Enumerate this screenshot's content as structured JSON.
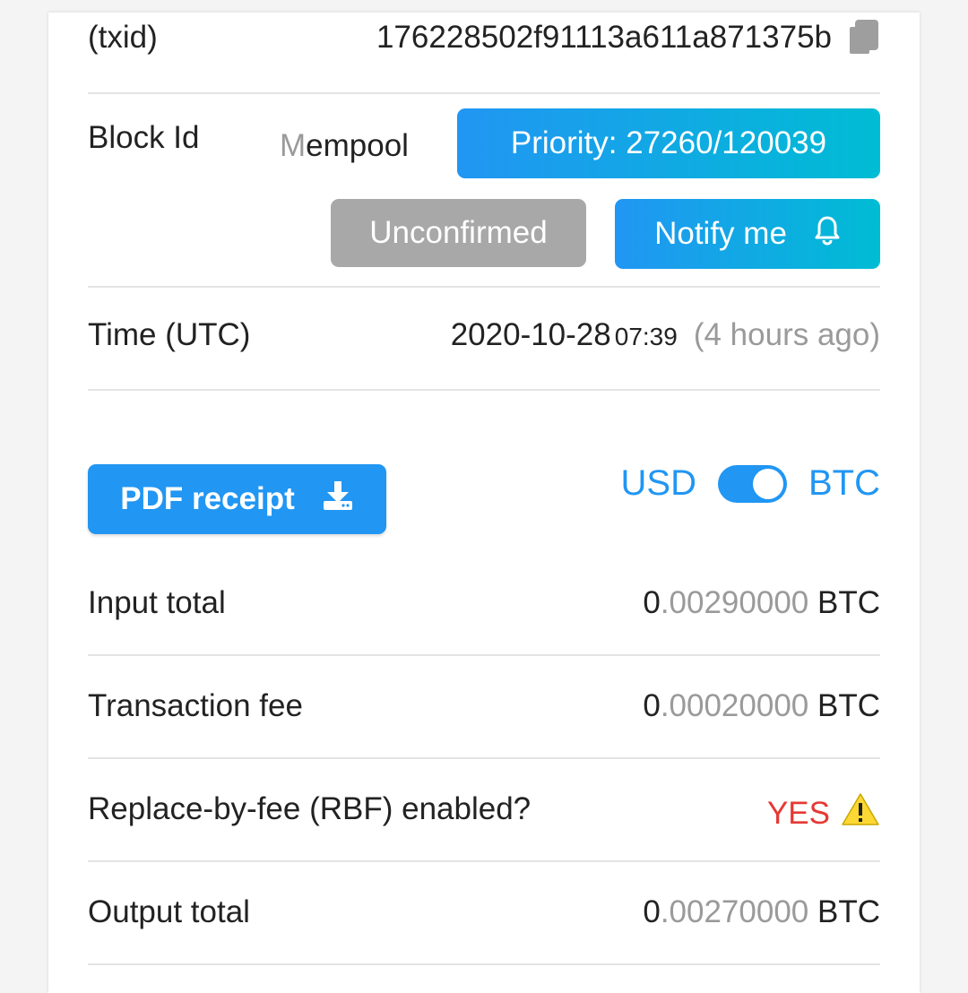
{
  "txid": {
    "label": "(txid)",
    "value": "176228502f91113a611a871375b",
    "copy_icon": "copy-icon"
  },
  "block": {
    "label": "Block Id",
    "mempool_first": "M",
    "mempool_rest": "empool",
    "priority": "Priority: 27260/120039",
    "status": "Unconfirmed",
    "notify_label": "Notify me",
    "notify_icon": "bell-icon"
  },
  "time": {
    "label": "Time (UTC)",
    "date": "2020-10-28",
    "clock": "07:39",
    "relative": "(4 hours ago)"
  },
  "actions": {
    "pdf_label": "PDF receipt",
    "pdf_icon": "download-icon",
    "currency_left": "USD",
    "currency_right": "BTC",
    "toggle_on": true
  },
  "summary": {
    "input_total": {
      "label": "Input total",
      "int": "0",
      "dec": ".00290000",
      "unit": " BTC"
    },
    "transaction_fee": {
      "label": "Transaction fee",
      "int": "0",
      "dec": ".00020000",
      "unit": " BTC"
    },
    "rbf": {
      "label": "Replace-by-fee (RBF) enabled?",
      "value": "YES",
      "icon": "warning-icon"
    },
    "output_total": {
      "label": "Output total",
      "int": "0",
      "dec": ".00270000",
      "unit": " BTC"
    }
  },
  "colors": {
    "accent": "#2196f3",
    "gradient_end": "#00bcd4",
    "warning": "#e53935",
    "muted": "#9a9a9a"
  }
}
